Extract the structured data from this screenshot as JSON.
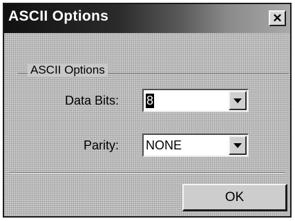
{
  "window": {
    "title": "ASCII Options",
    "close_glyph": "✕"
  },
  "group": {
    "label": "ASCII Options"
  },
  "fields": {
    "data_bits": {
      "label": "Data Bits:",
      "value": "8"
    },
    "parity": {
      "label": "Parity:",
      "value": "NONE"
    }
  },
  "buttons": {
    "ok_label": "OK"
  },
  "icons": {
    "close": "close-icon",
    "dropdown": "chevron-down-icon"
  }
}
